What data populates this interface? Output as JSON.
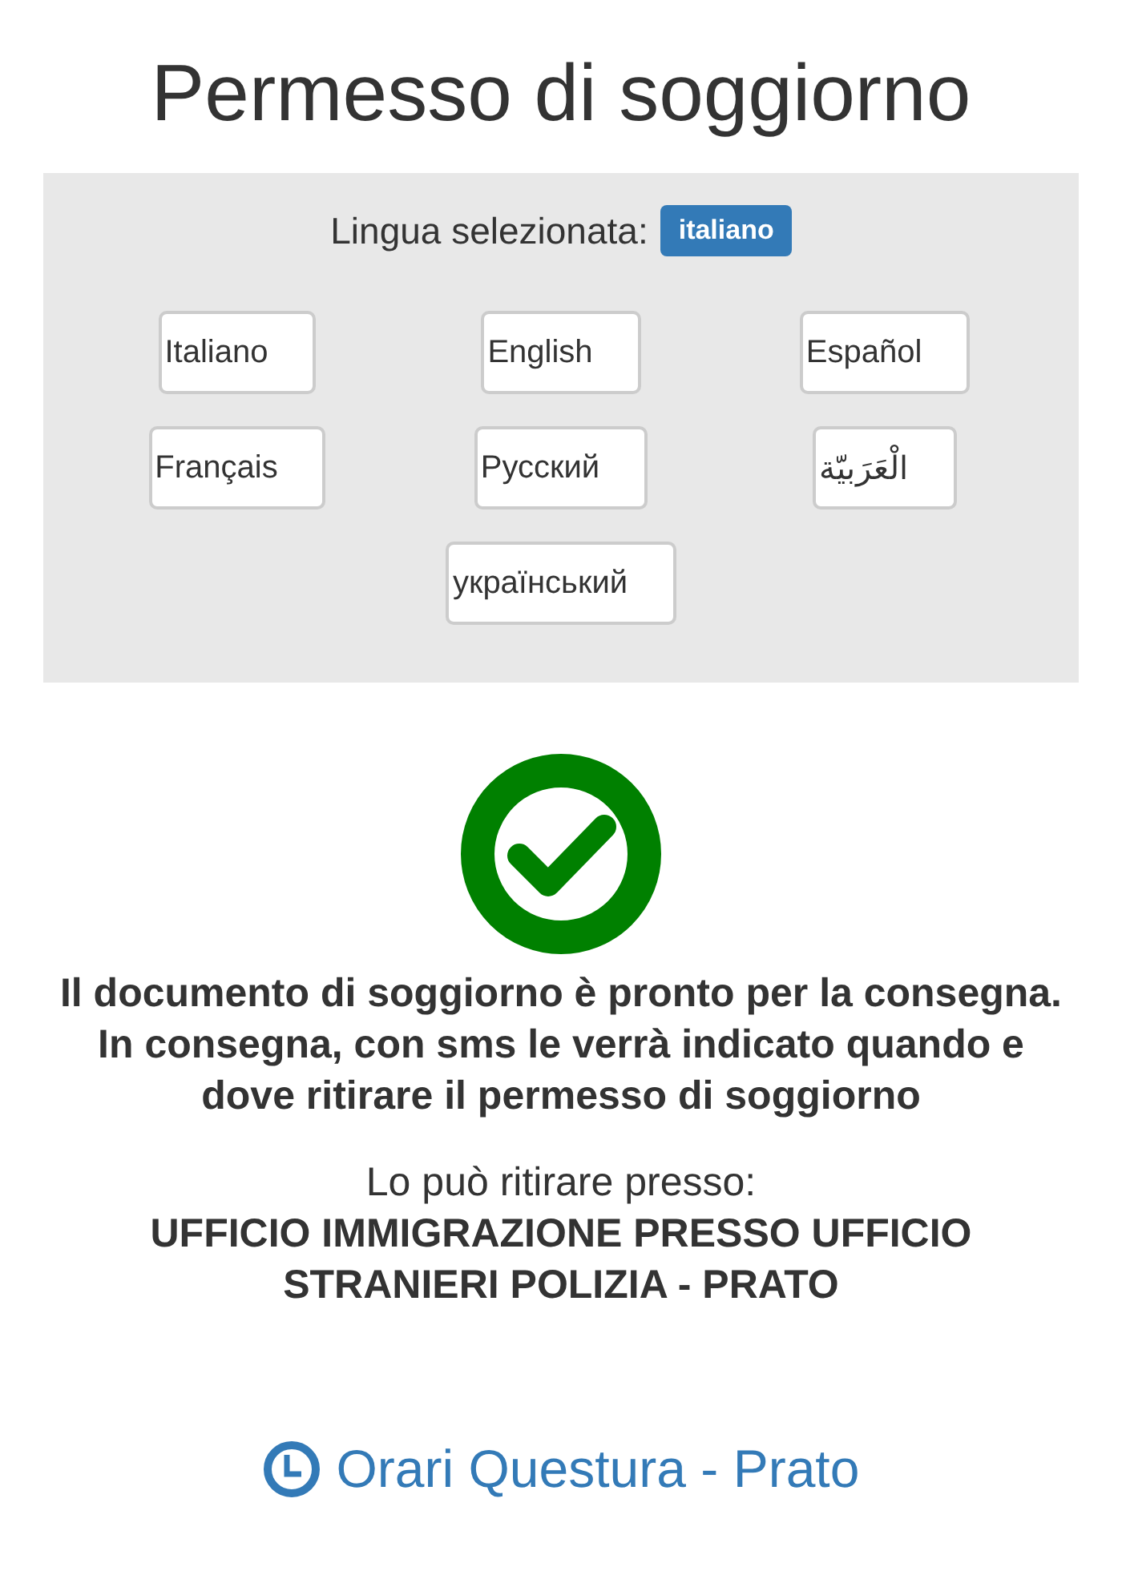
{
  "title": "Permesso di soggiorno",
  "language_panel": {
    "label": "Lingua selezionata:",
    "current_language": "italiano",
    "languages": [
      "Italiano",
      "English",
      "Español",
      "Français",
      "Русский",
      "الْعَرَبيّة",
      "український"
    ]
  },
  "status": {
    "kind": "ready",
    "message": "Il documento di soggiorno è pronto per la consegna.\nIn consegna, con sms le verrà indicato quando e dove ritirare il permesso di soggiorno",
    "pickup_label": "Lo può ritirare presso:",
    "pickup_office": "UFFICIO IMMIGRAZIONE PRESSO UFFICIO STRANIERI POLIZIA - PRATO"
  },
  "hours_link": "Orari Questura - Prato"
}
